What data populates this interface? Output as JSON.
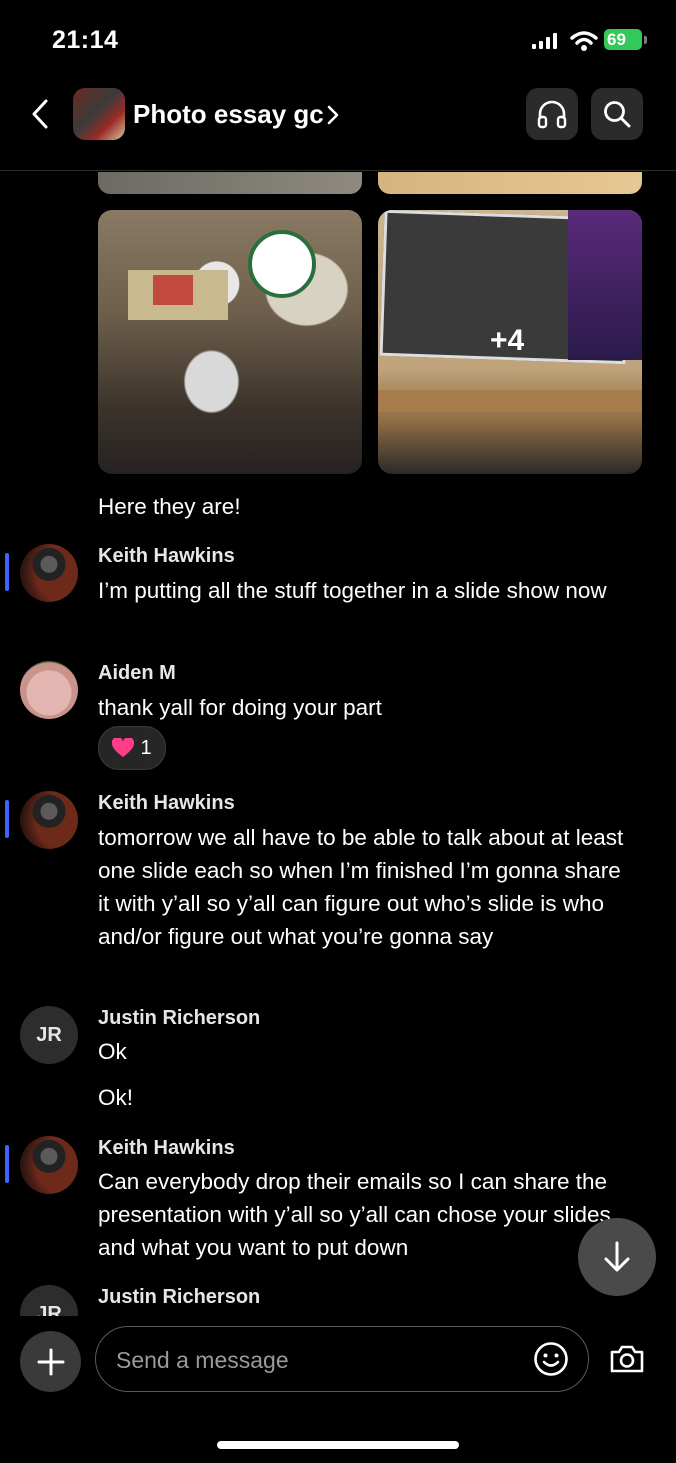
{
  "status_bar": {
    "time": "21:14",
    "battery": "69"
  },
  "header": {
    "title": "Photo essay gc"
  },
  "photos": {
    "more_count": "+4"
  },
  "messages": [
    {
      "text": "Here they are!"
    },
    {
      "sender": "Keith Hawkins",
      "text": "I’m putting all the stuff together in a slide show now"
    },
    {
      "sender": "Aiden  M",
      "text": "thank yall for doing your part",
      "reaction_count": "1"
    },
    {
      "sender": "Keith Hawkins",
      "text": "tomorrow we all have to be able to talk about at least one slide each so when I’m finished I’m gonna share it with y’all so y’all can figure out who’s slide is who and/or figure out what you’re gonna say"
    },
    {
      "sender": "Justin Richerson",
      "initials": "JR",
      "text": "Ok",
      "text2": "Ok!"
    },
    {
      "sender": "Keith Hawkins",
      "text": "Can everybody drop their emails so I can share the presentation with y’all so y’all can chose your slides and what you want to put down"
    },
    {
      "sender": "Justin Richerson",
      "initials": "JR"
    }
  ],
  "composer": {
    "placeholder": "Send a message"
  },
  "colors": {
    "unread_marker": "#3f63ff",
    "battery": "#34c759",
    "heart": "#ff3d8b"
  }
}
